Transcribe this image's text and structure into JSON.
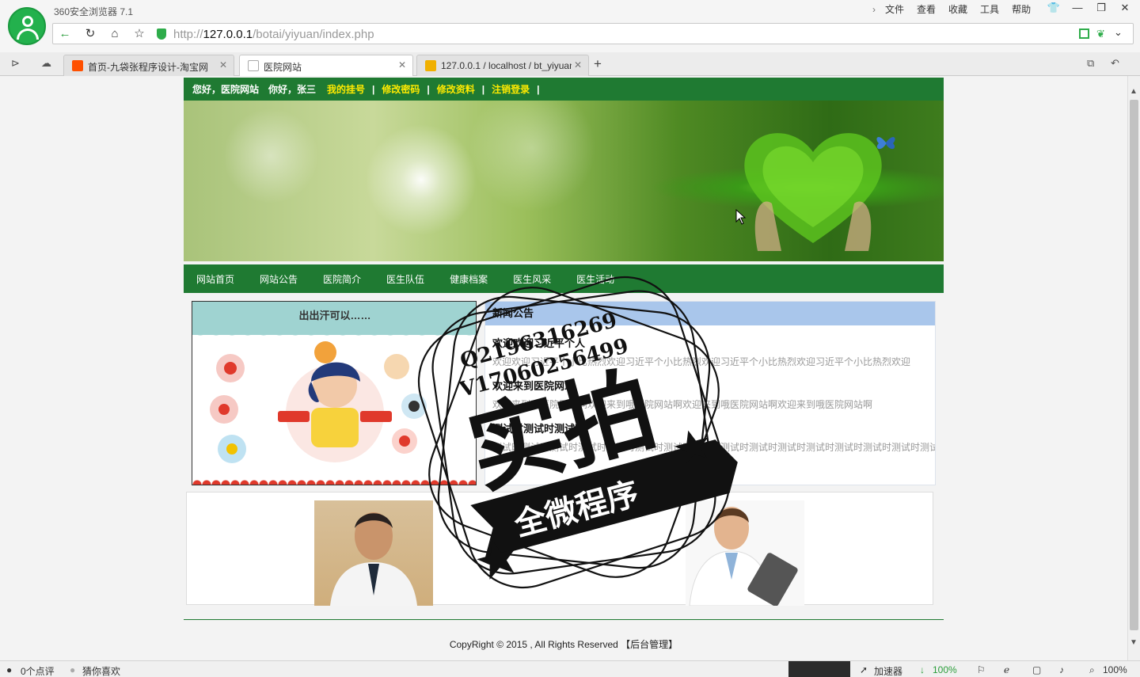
{
  "browser": {
    "app_title": "360安全浏览器 7.1",
    "menu": [
      "文件",
      "查看",
      "收藏",
      "工具",
      "帮助"
    ],
    "address": {
      "scheme": "http://",
      "host": "127.0.0.1",
      "path": "/botai/yiyuan/index.php"
    },
    "tabs": [
      {
        "label": "首页-九袋张程序设计-淘宝网",
        "icon_color": "#ff5000"
      },
      {
        "label": "医院网站",
        "icon_color": "#dddddd"
      },
      {
        "label": "127.0.0.1 / localhost / bt_yiyuan",
        "icon_color": "#f0b000"
      }
    ]
  },
  "site": {
    "topbar": {
      "greeting": "您好，医院网站",
      "user": "你好，张三",
      "links": [
        "我的挂号",
        "修改密码",
        "修改资料",
        "注销登录"
      ],
      "separator": "|"
    },
    "nav": [
      "网站首页",
      "网站公告",
      "医院简介",
      "医生队伍",
      "健康档案",
      "医生风采",
      "医生活动"
    ],
    "promo_caption": "出出汗可以……",
    "news": {
      "heading": "新闻公告",
      "items": [
        {
          "title": "欢迎欢迎习近平个人",
          "desc": "欢迎欢迎习近平个小比热烈欢迎习近平个小比热烈欢迎习近平个小比热烈欢迎习近平个小比热烈欢迎"
        },
        {
          "title": "欢迎来到医院网站",
          "desc": "欢迎来到哦医院网站啊欢迎来到哦医院网站啊欢迎来到哦医院网站啊欢迎来到哦医院网站啊"
        },
        {
          "title": "测试时测试时测试时",
          "desc": "测试时测试时测试时测试时测试时测试时测试时测试时测试时测试时测试时测试时测试时测试时测试时测试时"
        }
      ]
    },
    "copyright": "CopyRight © 2015 , All Rights Reserved",
    "admin_link": "【后台管理】"
  },
  "stamp": {
    "qq": "Q2196316269",
    "wechat": "V17060256499",
    "big": "实拍",
    "banner": "全微程序"
  },
  "statusbar": {
    "reviews": "0个点评",
    "guess": "猜你喜欢",
    "accelerator": "加速器",
    "download": "100%",
    "zoom": "100%"
  },
  "colors": {
    "site_green": "#1f7a32",
    "link_yellow": "#ffea00",
    "news_header": "#a9c6eb"
  }
}
